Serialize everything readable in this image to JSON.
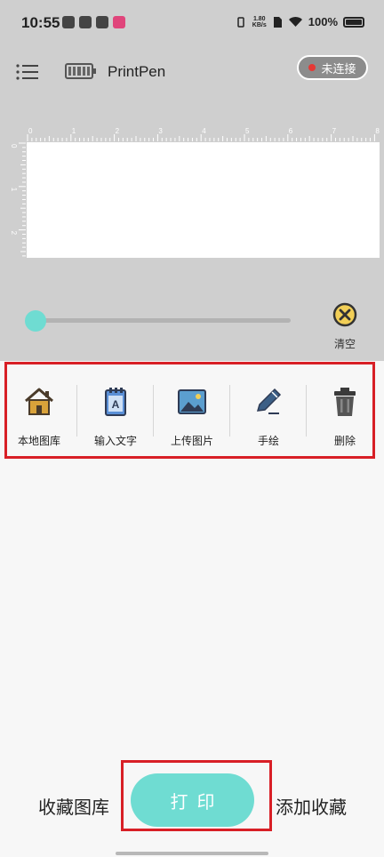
{
  "status_bar": {
    "time": "10:55",
    "net_speed_top": "1.80",
    "net_speed_bottom": "KB/s",
    "battery": "100%"
  },
  "header": {
    "app_title": "PrintPen",
    "connection_label": "未连接",
    "connection_dot_color": "#e53935"
  },
  "ruler": {
    "top_labels": [
      "0",
      "1",
      "2",
      "3",
      "4",
      "5",
      "6",
      "7",
      "8"
    ],
    "left_labels": [
      "0",
      "1",
      "2"
    ]
  },
  "slider": {
    "value": 0
  },
  "clear": {
    "label": "清空"
  },
  "tools": [
    {
      "label": "本地图库",
      "icon": "home-icon"
    },
    {
      "label": "输入文字",
      "icon": "notepad-text-icon"
    },
    {
      "label": "上传图片",
      "icon": "image-icon"
    },
    {
      "label": "手绘",
      "icon": "pen-icon"
    },
    {
      "label": "删除",
      "icon": "trash-icon"
    }
  ],
  "bottom": {
    "left_label": "收藏图库",
    "print_label": "打印",
    "right_label": "添加收藏"
  },
  "colors": {
    "accent": "#6fdcd2",
    "highlight": "#d81f26"
  }
}
